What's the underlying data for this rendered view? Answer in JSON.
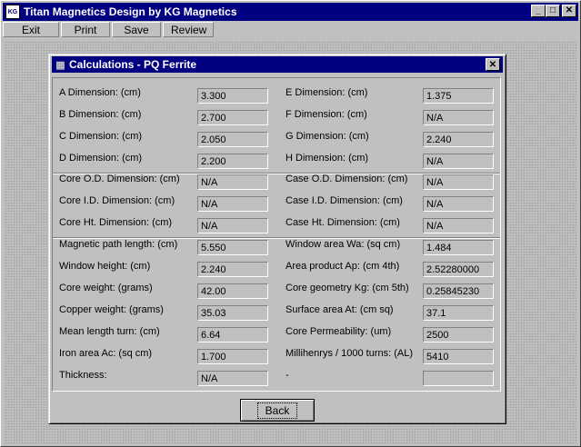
{
  "window": {
    "title": "Titan Magnetics Design by KG Magnetics",
    "icon": "KG"
  },
  "menu": [
    "Exit",
    "Print",
    "Save",
    "Review"
  ],
  "dialog": {
    "title": "Calculations - PQ Ferrite",
    "back_label": "Back"
  },
  "left": [
    {
      "label": "A Dimension: (cm)",
      "value": "3.300"
    },
    {
      "label": "B Dimension: (cm)",
      "value": "2.700"
    },
    {
      "label": "C Dimension: (cm)",
      "value": "2.050"
    },
    {
      "label": "D Dimension: (cm)",
      "value": "2.200"
    },
    {
      "label": "Core O.D. Dimension: (cm)",
      "value": "N/A"
    },
    {
      "label": "Core I.D. Dimension: (cm)",
      "value": "N/A"
    },
    {
      "label": "Core Ht. Dimension: (cm)",
      "value": "N/A"
    },
    {
      "label": "Magnetic path length: (cm)",
      "value": "5.550"
    },
    {
      "label": "Window height: (cm)",
      "value": "2.240"
    },
    {
      "label": "Core weight: (grams)",
      "value": "42.00"
    },
    {
      "label": "Copper weight: (grams)",
      "value": "35.03"
    },
    {
      "label": "Mean length turn: (cm)",
      "value": "6.64"
    },
    {
      "label": "Iron area Ac: (sq cm)",
      "value": "1.700"
    },
    {
      "label": "Thickness:",
      "value": "N/A"
    }
  ],
  "right": [
    {
      "label": "E Dimension: (cm)",
      "value": "1.375"
    },
    {
      "label": "F Dimension: (cm)",
      "value": "N/A"
    },
    {
      "label": "G Dimension: (cm)",
      "value": "2.240"
    },
    {
      "label": "H Dimension: (cm)",
      "value": "N/A"
    },
    {
      "label": "Case O.D. Dimension: (cm)",
      "value": "N/A"
    },
    {
      "label": "Case I.D. Dimension: (cm)",
      "value": "N/A"
    },
    {
      "label": "Case Ht. Dimension: (cm)",
      "value": "N/A"
    },
    {
      "label": "Window area Wa: (sq cm)",
      "value": "1.484"
    },
    {
      "label": "Area product Ap: (cm 4th)",
      "value": "2.52280000"
    },
    {
      "label": "Core geometry Kg: (cm 5th)",
      "value": "0.25845230"
    },
    {
      "label": "Surface area At: (cm sq)",
      "value": "37.1"
    },
    {
      "label": "Core Permeability: (um)",
      "value": "2500"
    },
    {
      "label": "Millihenrys / 1000 turns: (AL)",
      "value": "5410"
    },
    {
      "label": "-",
      "value": ""
    }
  ]
}
